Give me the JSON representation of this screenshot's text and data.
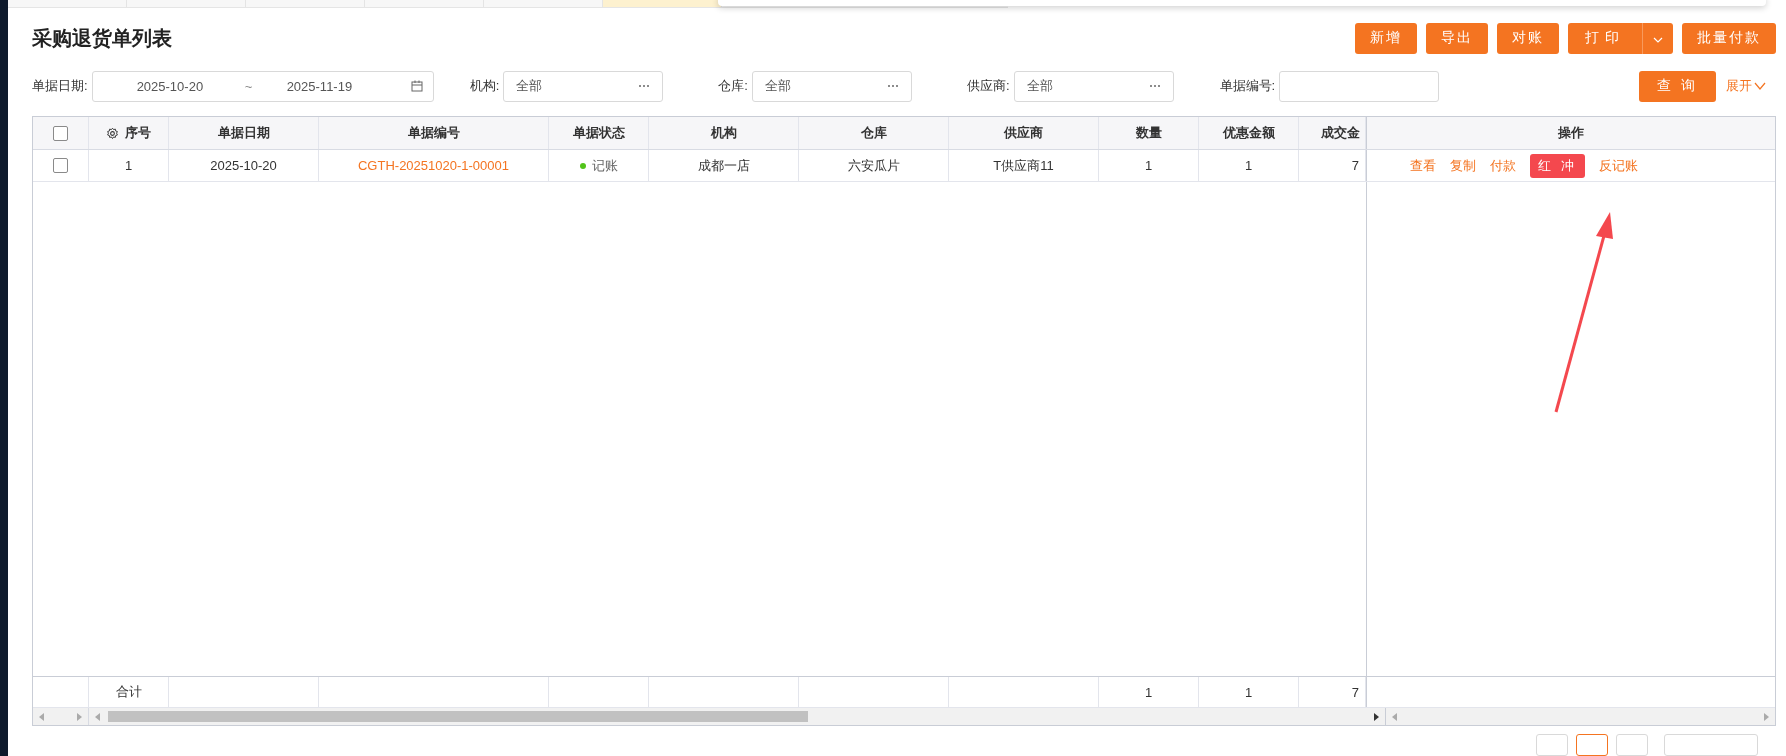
{
  "tabs": [
    {
      "selected": false
    },
    {
      "selected": false
    },
    {
      "selected": false
    },
    {
      "selected": false
    },
    {
      "selected": false
    },
    {
      "selected": true
    }
  ],
  "title": "采购退货单列表",
  "actions": [
    {
      "label": "新增",
      "kind": "button"
    },
    {
      "label": "导出",
      "kind": "button"
    },
    {
      "label": "对账",
      "kind": "button"
    },
    {
      "label": "打印",
      "kind": "split"
    },
    {
      "label": "批量付款",
      "kind": "button"
    }
  ],
  "filters": [
    {
      "label": "单据日期:",
      "kind": "daterange",
      "from": "2025-10-20",
      "separator": "~",
      "to": "2025-11-19"
    },
    {
      "label": "机构:",
      "kind": "picker",
      "value": "全部"
    },
    {
      "label": "仓库:",
      "kind": "picker",
      "value": "全部"
    },
    {
      "label": "供应商:",
      "kind": "picker",
      "value": "全部"
    },
    {
      "label": "单据编号:",
      "kind": "text"
    }
  ],
  "search_button": "查 询",
  "expand_link": "展开",
  "table": {
    "header_checked": false,
    "columns": [
      {
        "label": "序号",
        "kind": "index"
      },
      {
        "label": "单据日期",
        "kind": "plain"
      },
      {
        "label": "单据编号",
        "kind": "link"
      },
      {
        "label": "单据状态",
        "kind": "status"
      },
      {
        "label": "机构",
        "kind": "plain"
      },
      {
        "label": "仓库",
        "kind": "plain"
      },
      {
        "label": "供应商",
        "kind": "plain"
      },
      {
        "label": "数量",
        "kind": "plain",
        "total": "1"
      },
      {
        "label": "优惠金额",
        "kind": "plain",
        "total": "1"
      },
      {
        "label": "成交金",
        "kind": "amount",
        "total": "7"
      }
    ],
    "actions_header": "操作",
    "rows": [
      {
        "checked": false,
        "color": "#52c41a",
        "cells": [
          "1",
          "2025-10-20",
          "CGTH-20251020-1-00001",
          "记账",
          "成都一店",
          "六安瓜片",
          "T供应商11",
          "1",
          "1",
          "7"
        ],
        "actions": [
          {
            "label": "查看",
            "highlighted": false
          },
          {
            "label": "复制",
            "highlighted": false
          },
          {
            "label": "付款",
            "highlighted": false
          },
          {
            "label": "红 冲",
            "highlighted": true
          },
          {
            "label": "反记账",
            "highlighted": false
          }
        ]
      }
    ],
    "footer": {
      "label": "合计"
    }
  },
  "pager": [
    {
      "selected": false
    },
    {
      "selected": true
    },
    {
      "selected": false
    }
  ]
}
